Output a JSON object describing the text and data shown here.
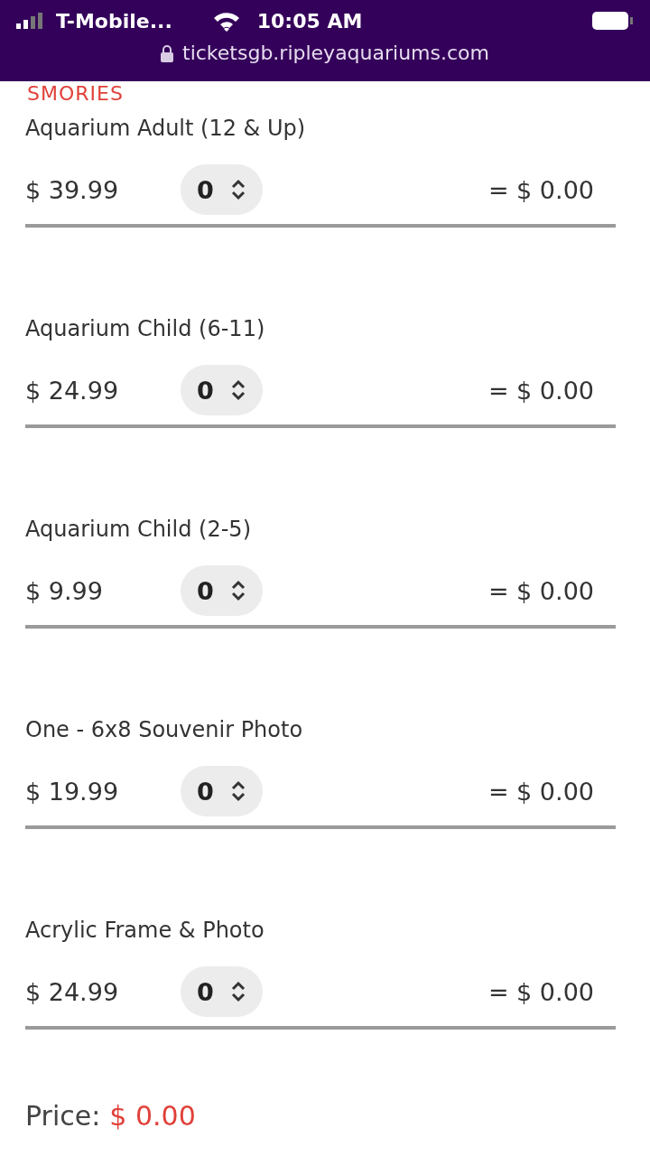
{
  "status_bar": {
    "carrier": "T-Mobile...",
    "time": "10:05 AM",
    "url": "ticketsgb.ripleyaquariums.com"
  },
  "section_heading": "SMORIES",
  "items": [
    {
      "name": "Aquarium Adult (12 & Up)",
      "price": "$ 39.99",
      "quantity": "0",
      "total": "= $ 0.00"
    },
    {
      "name": "Aquarium Child (6-11)",
      "price": "$ 24.99",
      "quantity": "0",
      "total": "= $ 0.00"
    },
    {
      "name": "Aquarium Child (2-5)",
      "price": "$ 9.99",
      "quantity": "0",
      "total": "= $ 0.00"
    },
    {
      "name": "One - 6x8 Souvenir Photo",
      "price": "$ 19.99",
      "quantity": "0",
      "total": "= $ 0.00"
    },
    {
      "name": "Acrylic Frame & Photo",
      "price": "$ 24.99",
      "quantity": "0",
      "total": "= $ 0.00"
    }
  ],
  "price_label": "Price:",
  "price_value": "$ 0.00"
}
